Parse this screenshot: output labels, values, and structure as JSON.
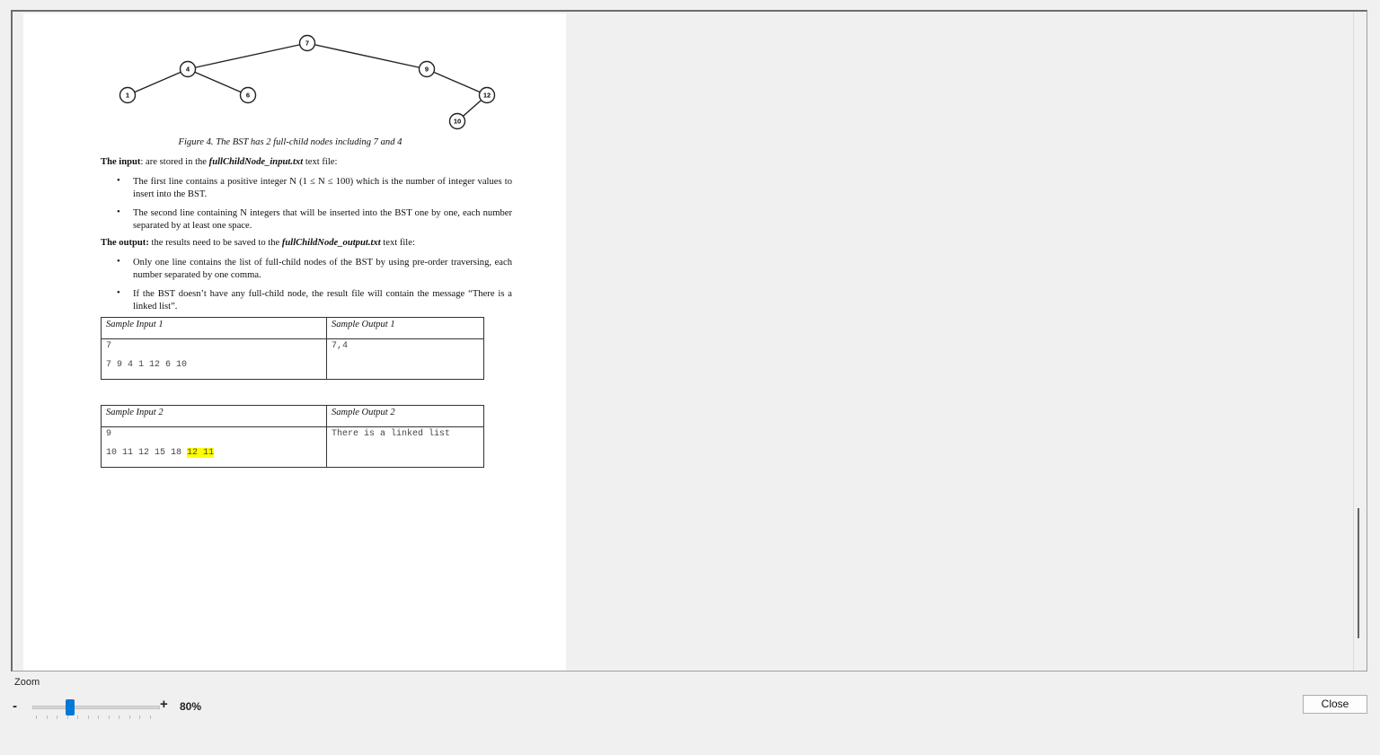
{
  "document": {
    "tree_nodes": [
      "7",
      "4",
      "9",
      "1",
      "6",
      "12",
      "10"
    ],
    "caption": "Figure 4. The BST has 2 full-child nodes including 7 and 4",
    "input_para": {
      "lead": "The input",
      "mid": ": are stored in the ",
      "file": "fullChildNode_input.txt",
      "tail": " text file:"
    },
    "input_bullets": [
      "The first line contains a positive integer N (1 ≤ N ≤ 100) which is the number of integer values to insert into the BST.",
      "The second line containing N integers that will be inserted into the BST one by one, each number separated by at least one space."
    ],
    "output_para": {
      "lead": "The output:",
      "mid": " the results need to be saved to the ",
      "file": "fullChildNode_output.txt",
      "tail": " text file:"
    },
    "output_bullets": [
      "Only one line contains the list of full-child nodes of the BST by using pre-order traversing, each number separated by one comma.",
      "If the BST doesn’t have any full-child node, the result file will contain the message “There is a linked list”."
    ],
    "bullet_char": "•",
    "sample1": {
      "input_header": "Sample Input 1",
      "output_header": "Sample Output 1",
      "input_line1": "7",
      "input_line2": "7 9 4 1 12 6 10",
      "output": "7,4"
    },
    "sample2": {
      "input_header": "Sample Input 2",
      "output_header": "Sample Output 2",
      "input_line1": "9",
      "input_line2_plain": "10 11 12 15 18 ",
      "input_line2_highlight": "12 11",
      "output": "There is a linked list"
    }
  },
  "zoom": {
    "label": "Zoom",
    "minus": "-",
    "plus": "+",
    "value_text": "80%",
    "slider_fraction": 0.3
  },
  "buttons": {
    "close": "Close"
  },
  "colors": {
    "slider_thumb": "#0078d7",
    "highlight": "#ffff00"
  }
}
